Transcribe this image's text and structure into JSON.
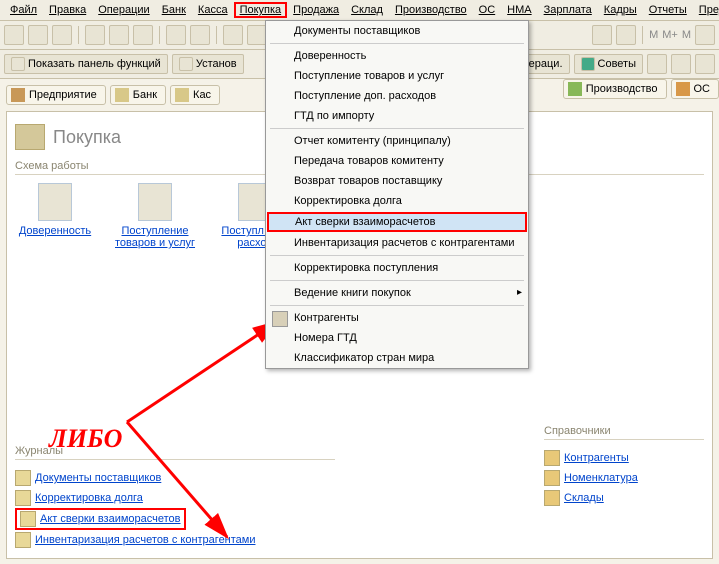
{
  "menubar": [
    "Файл",
    "Правка",
    "Операции",
    "Банк",
    "Касса",
    "Покупка",
    "Продажа",
    "Склад",
    "Производство",
    "ОС",
    "НМА",
    "Зарплата",
    "Кадры",
    "Отчеты",
    "Предпри"
  ],
  "menubar_highlight": 5,
  "toolbar2": {
    "b1": "Показать панель функций",
    "b2": "Установ",
    "b3": "ераци.",
    "b4": "Советы"
  },
  "tabs": [
    {
      "label": "Предприятие",
      "icon": "enterprise-icon"
    },
    {
      "label": "Банк",
      "icon": "bank-icon"
    },
    {
      "label": "Кас",
      "icon": "cash-icon"
    }
  ],
  "right_tabs": [
    {
      "label": "Производство",
      "icon": "production-icon"
    },
    {
      "label": "ОС",
      "icon": "os-icon"
    }
  ],
  "panel": {
    "title": "Покупка"
  },
  "sections": {
    "scheme": "Схема работы",
    "journals": "Журналы",
    "refs": "Справочники"
  },
  "scheme": [
    {
      "label": "Доверенность"
    },
    {
      "label": "Поступление товаров и услуг"
    },
    {
      "label": "Поступл доп. расход"
    }
  ],
  "dropdown": [
    {
      "label": "Документы поставщиков",
      "sep": true
    },
    {
      "label": "Доверенность"
    },
    {
      "label": "Поступление товаров и услуг"
    },
    {
      "label": "Поступление доп. расходов"
    },
    {
      "label": "ГТД по импорту",
      "sep": true
    },
    {
      "label": "Отчет комитенту (принципалу)"
    },
    {
      "label": "Передача товаров комитенту"
    },
    {
      "label": "Возврат товаров поставщику"
    },
    {
      "label": "Корректировка долга"
    },
    {
      "label": "Акт сверки взаиморасчетов",
      "hl": true
    },
    {
      "label": "Инвентаризация расчетов с контрагентами",
      "sep": true
    },
    {
      "label": "Корректировка поступления",
      "sep": true
    },
    {
      "label": "Ведение книги покупок",
      "arrow": true,
      "sep": true
    },
    {
      "label": "Контрагенты",
      "icon": true
    },
    {
      "label": "Номера ГТД"
    },
    {
      "label": "Классификатор стран мира"
    }
  ],
  "libo": "ЛИБО",
  "journals": [
    {
      "label": "Документы поставщиков"
    },
    {
      "label": "Корректировка долга"
    },
    {
      "label": "Акт сверки взаиморасчетов",
      "hl": true
    },
    {
      "label": "Инвентаризация расчетов с контрагентами"
    }
  ],
  "refs": [
    {
      "label": "Контрагенты"
    },
    {
      "label": "Номенклатура"
    },
    {
      "label": "Склады"
    }
  ]
}
